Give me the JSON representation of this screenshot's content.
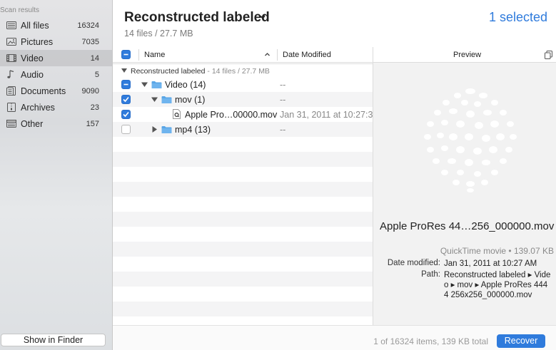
{
  "sidebar": {
    "header": "Scan results",
    "items": [
      {
        "label": "All files",
        "count": "16324",
        "icon": "drive-icon"
      },
      {
        "label": "Pictures",
        "count": "7035",
        "icon": "picture-icon"
      },
      {
        "label": "Video",
        "count": "14",
        "icon": "film-icon"
      },
      {
        "label": "Audio",
        "count": "5",
        "icon": "music-note-icon"
      },
      {
        "label": "Documents",
        "count": "9090",
        "icon": "document-icon"
      },
      {
        "label": "Archives",
        "count": "23",
        "icon": "archive-icon"
      },
      {
        "label": "Other",
        "count": "157",
        "icon": "other-icon"
      }
    ],
    "finder_button": "Show in Finder"
  },
  "header": {
    "title": "Reconstructed labeled",
    "subtitle": "14 files / 27.7 MB",
    "selected": "1 selected"
  },
  "table": {
    "col_name": "Name",
    "col_date": "Date Modified",
    "group_label": "Reconstructed labeled",
    "group_meta": " - 14 files / 27.7 MB",
    "rows": [
      {
        "name": "Video (14)",
        "date": "--"
      },
      {
        "name": "mov (1)",
        "date": "--"
      },
      {
        "name": "Apple Pro…00000.mov",
        "date": "Jan 31, 2011 at 10:27:3…"
      },
      {
        "name": "mp4 (13)",
        "date": "--"
      }
    ]
  },
  "preview": {
    "title": "Preview",
    "file_name": "Apple ProRes 44…256_000000.mov",
    "kind": "QuickTime movie • 139.07 KB",
    "date_label": "Date modified:",
    "date_value": "Jan 31, 2011 at 10:27 AM",
    "path_label": "Path:",
    "path_value": "Reconstructed labeled ▸ Video ▸ mov ▸ Apple ProRes 4444 256x256_000000.mov"
  },
  "footer": {
    "status": "1 of 16324 items, 139 KB total",
    "recover": "Recover"
  },
  "colors": {
    "accent": "#2f7bdc",
    "folder": "#5aa6e6"
  }
}
